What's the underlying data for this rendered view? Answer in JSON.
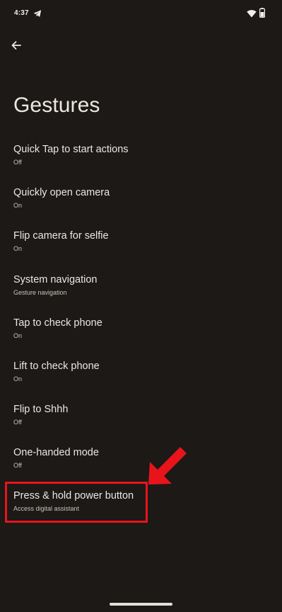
{
  "status_bar": {
    "time": "4:37",
    "icons": [
      "telegram-icon",
      "wifi-icon",
      "battery-icon"
    ]
  },
  "header": {
    "back_icon": "arrow-left-icon",
    "title": "Gestures"
  },
  "settings_items": [
    {
      "title": "Quick Tap to start actions",
      "summary": "Off"
    },
    {
      "title": "Quickly open camera",
      "summary": "On"
    },
    {
      "title": "Flip camera for selfie",
      "summary": "On"
    },
    {
      "title": "System navigation",
      "summary": "Gesture navigation"
    },
    {
      "title": "Tap to check phone",
      "summary": "On"
    },
    {
      "title": "Lift to check phone",
      "summary": "On"
    },
    {
      "title": "Flip to Shhh",
      "summary": "Off"
    },
    {
      "title": "One-handed mode",
      "summary": "Off"
    },
    {
      "title": "Press & hold power button",
      "summary": "Access digital assistant"
    }
  ],
  "annotation": {
    "highlight_color": "#e8141c",
    "arrow_icon": "red-arrow-icon"
  },
  "colors": {
    "background": "#1c1917",
    "text_primary": "#ece7e2",
    "text_secondary": "#c9c2bb"
  }
}
